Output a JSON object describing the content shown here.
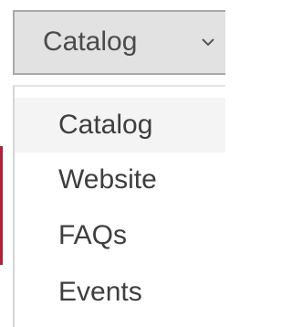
{
  "select": {
    "current_value": "Catalog",
    "chevron_icon": "chevron-down-icon"
  },
  "options": [
    {
      "label": "Catalog",
      "selected": true
    },
    {
      "label": "Website",
      "selected": false
    },
    {
      "label": "FAQs",
      "selected": false
    },
    {
      "label": "Events",
      "selected": false
    }
  ],
  "colors": {
    "select_bg": "#e2e2e2",
    "select_border": "#a9a9a9",
    "text": "#3e3e3e",
    "accent": "#b3203a"
  }
}
